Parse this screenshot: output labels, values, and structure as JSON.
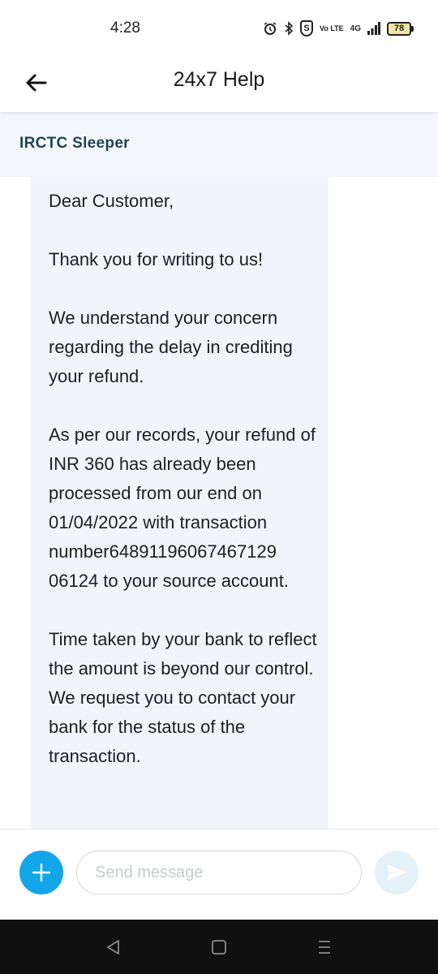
{
  "status_bar": {
    "time": "4:28",
    "network": "4G",
    "volte": "Vo LTE",
    "battery": "78"
  },
  "header": {
    "title": "24x7 Help"
  },
  "sub_header": {
    "title": "IRCTC Sleeper"
  },
  "message": {
    "paragraphs": [
      "Dear Customer,",
      "Thank you for writing to us!",
      "We understand your concern regarding the delay in crediting your refund.",
      "As per our records, your refund of INR 360 has already been processed from our end on 01/04/2022 with transaction number6489119606746712906124 to your source account.",
      "Time taken by your bank to reflect the amount is beyond our control. We request you to contact your bank for the status of the transaction."
    ]
  },
  "composer": {
    "placeholder": "Send message"
  },
  "colors": {
    "accent": "#12a6e8",
    "bubble": "#f1f5fa",
    "sub_header_text": "#234455"
  }
}
